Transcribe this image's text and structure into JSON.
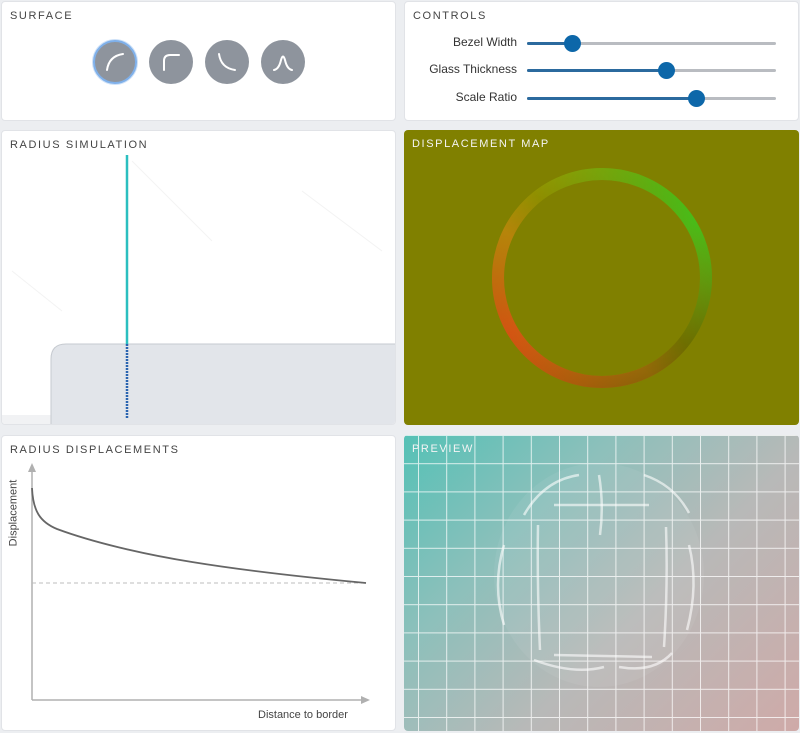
{
  "surface": {
    "title": "SURFACE",
    "options": [
      {
        "icon": "convex-circle-icon",
        "selected": true
      },
      {
        "icon": "squircle-icon",
        "selected": false
      },
      {
        "icon": "concave-icon",
        "selected": false
      },
      {
        "icon": "lip-icon",
        "selected": false
      }
    ]
  },
  "controls": {
    "title": "CONTROLS",
    "sliders": [
      {
        "label": "Bezel Width",
        "value": 0.18
      },
      {
        "label": "Glass Thickness",
        "value": 0.56
      },
      {
        "label": "Scale Ratio",
        "value": 0.68
      }
    ]
  },
  "radius_simulation": {
    "title": "RADIUS SIMULATION"
  },
  "displacement_map": {
    "title": "DISPLACEMENT MAP",
    "background": "#808000"
  },
  "radius_displacements": {
    "title": "RADIUS DISPLACEMENTS",
    "ylabel": "Displacement",
    "xlabel": "Distance to border"
  },
  "preview": {
    "title": "PREVIEW"
  },
  "colors": {
    "accent": "#0d67a9",
    "ray": "#2bbfc0"
  }
}
